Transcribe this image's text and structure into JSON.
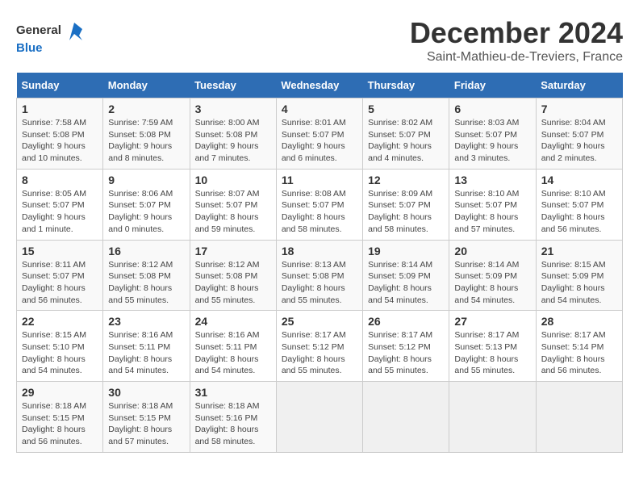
{
  "logo": {
    "line1": "General",
    "line2": "Blue"
  },
  "title": "December 2024",
  "location": "Saint-Mathieu-de-Treviers, France",
  "days_of_week": [
    "Sunday",
    "Monday",
    "Tuesday",
    "Wednesday",
    "Thursday",
    "Friday",
    "Saturday"
  ],
  "weeks": [
    [
      {
        "day": "1",
        "sunrise": "7:58 AM",
        "sunset": "5:08 PM",
        "daylight": "9 hours and 10 minutes."
      },
      {
        "day": "2",
        "sunrise": "7:59 AM",
        "sunset": "5:08 PM",
        "daylight": "9 hours and 8 minutes."
      },
      {
        "day": "3",
        "sunrise": "8:00 AM",
        "sunset": "5:08 PM",
        "daylight": "9 hours and 7 minutes."
      },
      {
        "day": "4",
        "sunrise": "8:01 AM",
        "sunset": "5:07 PM",
        "daylight": "9 hours and 6 minutes."
      },
      {
        "day": "5",
        "sunrise": "8:02 AM",
        "sunset": "5:07 PM",
        "daylight": "9 hours and 4 minutes."
      },
      {
        "day": "6",
        "sunrise": "8:03 AM",
        "sunset": "5:07 PM",
        "daylight": "9 hours and 3 minutes."
      },
      {
        "day": "7",
        "sunrise": "8:04 AM",
        "sunset": "5:07 PM",
        "daylight": "9 hours and 2 minutes."
      }
    ],
    [
      {
        "day": "8",
        "sunrise": "8:05 AM",
        "sunset": "5:07 PM",
        "daylight": "9 hours and 1 minute."
      },
      {
        "day": "9",
        "sunrise": "8:06 AM",
        "sunset": "5:07 PM",
        "daylight": "9 hours and 0 minutes."
      },
      {
        "day": "10",
        "sunrise": "8:07 AM",
        "sunset": "5:07 PM",
        "daylight": "8 hours and 59 minutes."
      },
      {
        "day": "11",
        "sunrise": "8:08 AM",
        "sunset": "5:07 PM",
        "daylight": "8 hours and 58 minutes."
      },
      {
        "day": "12",
        "sunrise": "8:09 AM",
        "sunset": "5:07 PM",
        "daylight": "8 hours and 58 minutes."
      },
      {
        "day": "13",
        "sunrise": "8:10 AM",
        "sunset": "5:07 PM",
        "daylight": "8 hours and 57 minutes."
      },
      {
        "day": "14",
        "sunrise": "8:10 AM",
        "sunset": "5:07 PM",
        "daylight": "8 hours and 56 minutes."
      }
    ],
    [
      {
        "day": "15",
        "sunrise": "8:11 AM",
        "sunset": "5:07 PM",
        "daylight": "8 hours and 56 minutes."
      },
      {
        "day": "16",
        "sunrise": "8:12 AM",
        "sunset": "5:08 PM",
        "daylight": "8 hours and 55 minutes."
      },
      {
        "day": "17",
        "sunrise": "8:12 AM",
        "sunset": "5:08 PM",
        "daylight": "8 hours and 55 minutes."
      },
      {
        "day": "18",
        "sunrise": "8:13 AM",
        "sunset": "5:08 PM",
        "daylight": "8 hours and 55 minutes."
      },
      {
        "day": "19",
        "sunrise": "8:14 AM",
        "sunset": "5:09 PM",
        "daylight": "8 hours and 54 minutes."
      },
      {
        "day": "20",
        "sunrise": "8:14 AM",
        "sunset": "5:09 PM",
        "daylight": "8 hours and 54 minutes."
      },
      {
        "day": "21",
        "sunrise": "8:15 AM",
        "sunset": "5:09 PM",
        "daylight": "8 hours and 54 minutes."
      }
    ],
    [
      {
        "day": "22",
        "sunrise": "8:15 AM",
        "sunset": "5:10 PM",
        "daylight": "8 hours and 54 minutes."
      },
      {
        "day": "23",
        "sunrise": "8:16 AM",
        "sunset": "5:11 PM",
        "daylight": "8 hours and 54 minutes."
      },
      {
        "day": "24",
        "sunrise": "8:16 AM",
        "sunset": "5:11 PM",
        "daylight": "8 hours and 54 minutes."
      },
      {
        "day": "25",
        "sunrise": "8:17 AM",
        "sunset": "5:12 PM",
        "daylight": "8 hours and 55 minutes."
      },
      {
        "day": "26",
        "sunrise": "8:17 AM",
        "sunset": "5:12 PM",
        "daylight": "8 hours and 55 minutes."
      },
      {
        "day": "27",
        "sunrise": "8:17 AM",
        "sunset": "5:13 PM",
        "daylight": "8 hours and 55 minutes."
      },
      {
        "day": "28",
        "sunrise": "8:17 AM",
        "sunset": "5:14 PM",
        "daylight": "8 hours and 56 minutes."
      }
    ],
    [
      {
        "day": "29",
        "sunrise": "8:18 AM",
        "sunset": "5:15 PM",
        "daylight": "8 hours and 56 minutes."
      },
      {
        "day": "30",
        "sunrise": "8:18 AM",
        "sunset": "5:15 PM",
        "daylight": "8 hours and 57 minutes."
      },
      {
        "day": "31",
        "sunrise": "8:18 AM",
        "sunset": "5:16 PM",
        "daylight": "8 hours and 58 minutes."
      },
      null,
      null,
      null,
      null
    ]
  ]
}
